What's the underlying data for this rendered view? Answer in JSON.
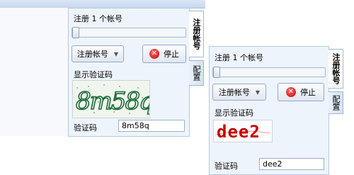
{
  "window1": {
    "register_count_label": "注册 1 个帐号",
    "slider_value": 0,
    "register_button": "注册帐号",
    "stop_button": "停止",
    "captcha_label": "显示验证码",
    "captcha_text": "8m58q",
    "verify_label": "验证码",
    "verify_value": "8m58q",
    "tab_register": "注册帐号",
    "tab_config": "配置"
  },
  "window2": {
    "register_count_label": "注册 1 个帐号",
    "slider_value": 0,
    "register_button": "注册帐号",
    "stop_button": "停止",
    "captcha_label": "显示验证码",
    "captcha_text": "dee2",
    "verify_label": "验证码",
    "verify_value": "dee2",
    "tab_register": "注册帐号",
    "tab_config": "配置"
  },
  "icons": {
    "stop": "stop-x-icon",
    "dropdown": "chevron-down-icon"
  },
  "colors": {
    "panel_bg": "#eef4fb",
    "stop_red": "#d40000",
    "captcha2_red": "#c40000",
    "captcha1_green": "#1f6b3a"
  }
}
